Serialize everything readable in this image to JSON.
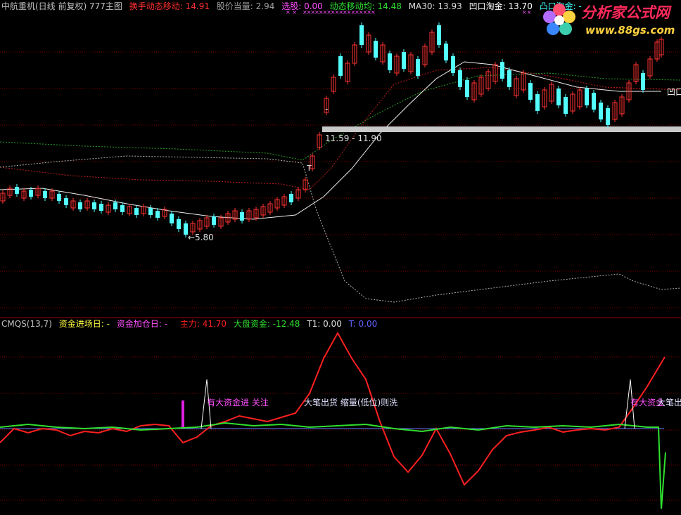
{
  "upper_header": {
    "title": "中航重机(日线 前复权) 777主图",
    "hsdt_label": "换手动态移动:",
    "hsdt_value": "14.91",
    "gjdl_label": "股价当量:",
    "gjdl_value": "2.94",
    "xg_label": "选股:",
    "xg_value": "0.00",
    "dtyd_label": "动态移动均:",
    "dtyd_value": "14.48",
    "ma30_label": "MA30:",
    "ma30_value": "13.93",
    "akt_label": "凹口淘金:",
    "akt_value": "13.70",
    "tkt_label": "凸口淘金:",
    "tkt_value": "-",
    "marks_1": "× ×",
    "marks_2": "××××××××××××××××××",
    "marks_3": "××"
  },
  "upper_annotations": {
    "resistance_label": "11.59 - 11.90",
    "low_label": "←5.80",
    "t_marker": "T",
    "dash_marker": "-",
    "right_edge_label": "凹口"
  },
  "lower_header": {
    "indicator": "CMQS(13,7)",
    "zjjc_label": "资金进场日:",
    "zjjc_value": "-",
    "zjjc2_label": "资金加仓日:",
    "zjjc2_value": "-",
    "zl_label": "主力:",
    "zl_value": "41.70",
    "dp_label": "大盘资金:",
    "dp_value": "-12.48",
    "t1_label": "T1:",
    "t1_value": "0.00",
    "t_label": "T:",
    "t_value": "0.00"
  },
  "lower_annotations": {
    "signal_1": "有大资金进 关注",
    "signal_2": "大笔出货 缩量(低位)则洗",
    "signal_3": "有大资金",
    "signal_4": "大笔出"
  },
  "logo": {
    "brand": "分析家公式网",
    "url": "www.88gs.com"
  },
  "colors": {
    "background": "#000000",
    "grid": "#7a0000",
    "up": "#ff3232",
    "down": "#54ffff",
    "main_force": "#ff2020",
    "market_fund": "#30e030",
    "label_magenta": "#ff50ff",
    "label_green": "#30e030",
    "label_yellow": "#ffff40"
  }
}
